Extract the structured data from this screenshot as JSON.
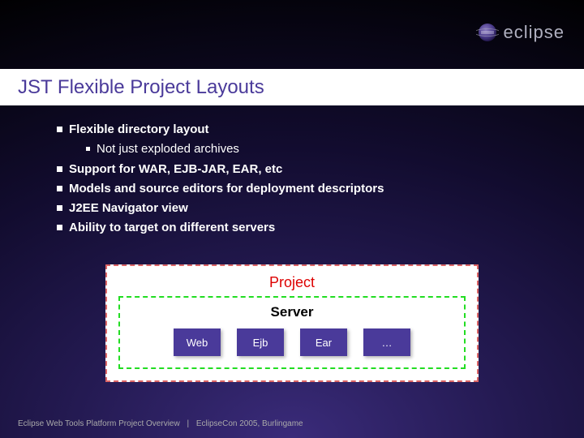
{
  "brand": "eclipse",
  "title": "JST Flexible Project Layouts",
  "bullets": {
    "b1": "Flexible directory layout",
    "b1a": "Not just exploded archives",
    "b2": "Support for WAR, EJB-JAR, EAR, etc",
    "b3": "Models and source editors for deployment descriptors",
    "b4": "J2EE Navigator view",
    "b5": "Ability to target on different servers"
  },
  "diagram": {
    "project": "Project",
    "server": "Server",
    "modules": [
      "Web",
      "Ejb",
      "Ear",
      "…"
    ]
  },
  "footer": {
    "left": "Eclipse Web Tools Platform Project Overview",
    "right": "EclipseCon 2005, Burlingame"
  }
}
